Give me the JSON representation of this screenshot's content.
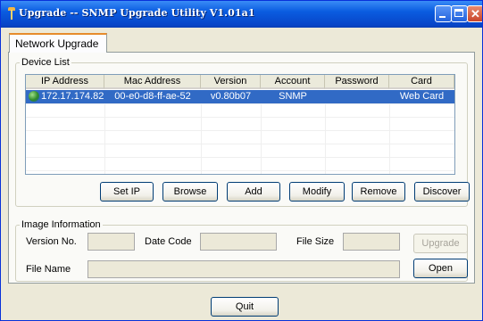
{
  "window": {
    "title": "Upgrade -- SNMP Upgrade Utility V1.01a1",
    "minimize_glyph": "",
    "maximize_glyph": "",
    "close_glyph": "✕"
  },
  "tabs": [
    {
      "label": "Network Upgrade",
      "selected": true
    }
  ],
  "device_list": {
    "caption": "Device List",
    "columns": [
      "IP Address",
      "Mac Address",
      "Version",
      "Account",
      "Password",
      "Card"
    ],
    "rows": [
      {
        "ip": "172.17.174.82",
        "mac": "00-e0-d8-ff-ae-52",
        "version": "v0.80b07",
        "account": "SNMP",
        "password": "",
        "card": "Web Card",
        "selected": true,
        "icon": "network-device-icon"
      }
    ],
    "buttons": {
      "set_ip": {
        "label": "Set IP",
        "mnemonic": ""
      },
      "browse": {
        "label": "Browse",
        "mnemonic": "B"
      },
      "add": {
        "label": "Add",
        "mnemonic": "A"
      },
      "modify": {
        "label": "Modify",
        "mnemonic": "M"
      },
      "remove": {
        "label": "Remove",
        "mnemonic": "R"
      },
      "discover": {
        "label": "Discover",
        "mnemonic": "D"
      }
    }
  },
  "image_info": {
    "caption": "Image Information",
    "version_label": "Version No.",
    "version_value": "",
    "date_label": "Date Code",
    "date_value": "",
    "size_label": "File Size",
    "size_value": "",
    "filename_label": "File Name",
    "filename_value": "",
    "upgrade_label": "Upgrade",
    "upgrade_enabled": false,
    "open_label": "Open"
  },
  "footer": {
    "quit_label": "Quit"
  },
  "colors": {
    "title_bar": "#0a5ce0",
    "selection": "#316ac5",
    "window_bg": "#ece9d8",
    "tab_accent": "#e68b2c"
  }
}
